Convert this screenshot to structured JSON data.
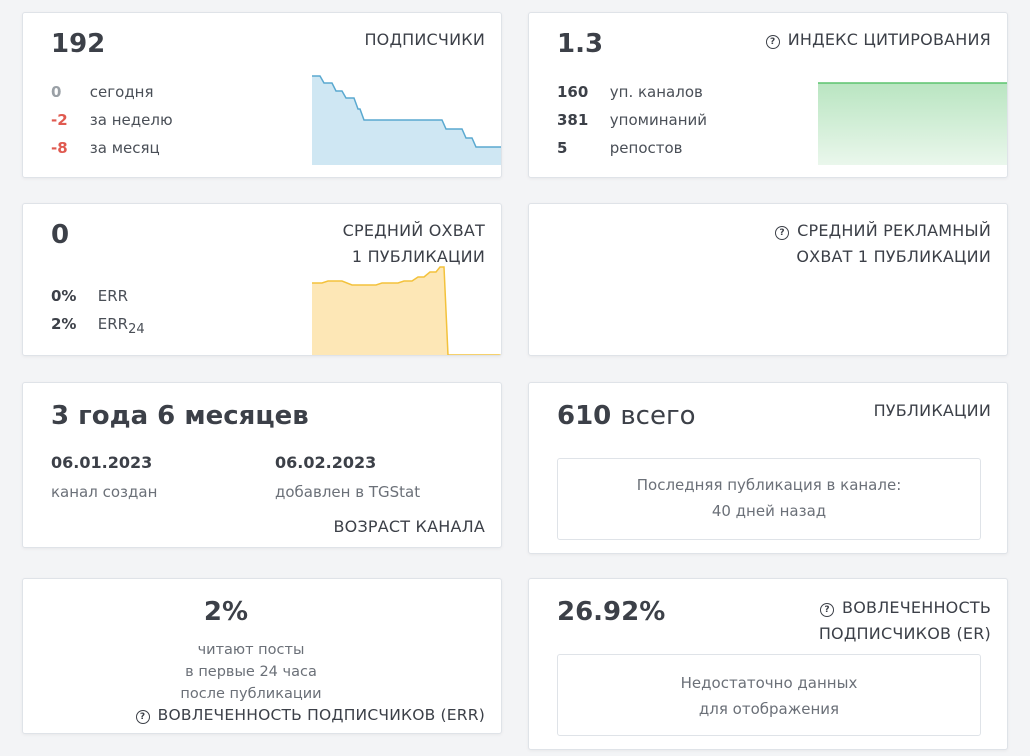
{
  "subscribers": {
    "value": "192",
    "title": "ПОДПИСЧИКИ",
    "rows": [
      {
        "num": "0",
        "label": "сегодня"
      },
      {
        "num": "-2",
        "label": "за неделю"
      },
      {
        "num": "-8",
        "label": "за месяц"
      }
    ]
  },
  "citation": {
    "value": "1.3",
    "title": "ИНДЕКС ЦИТИРОВАНИЯ",
    "rows": [
      {
        "num": "160",
        "label": "уп. каналов"
      },
      {
        "num": "381",
        "label": "упоминаний"
      },
      {
        "num": "5",
        "label": "репостов"
      }
    ]
  },
  "reach": {
    "value": "0",
    "title_line1": "СРЕДНИЙ ОХВАТ",
    "title_line2": "1 ПУБЛИКАЦИИ",
    "err_value": "0%",
    "err_label": "ERR",
    "err24_value": "2%",
    "err24_label": "ERR",
    "err24_sub": "24"
  },
  "ad_reach": {
    "title_line1": "СРЕДНИЙ РЕКЛАМНЫЙ",
    "title_line2": "ОХВАТ 1 ПУБЛИКАЦИИ"
  },
  "age": {
    "value": "3 года 6 месяцев",
    "created_date": "06.01.2023",
    "created_label": "канал создан",
    "added_date": "06.02.2023",
    "added_label": "добавлен в TGStat",
    "title": "ВОЗРАСТ КАНАЛА"
  },
  "posts": {
    "value": "610",
    "value_suffix": "всего",
    "title": "ПУБЛИКАЦИИ",
    "last_line1": "Последняя публикация в канале:",
    "last_line2": "40 дней назад"
  },
  "err_card": {
    "value": "2%",
    "desc_line1": "читают посты",
    "desc_line2": "в первые 24 часа",
    "desc_line3": "после публикации",
    "title": "ВОВЛЕЧЕННОСТЬ ПОДПИСЧИКОВ (ERR)"
  },
  "er_card": {
    "value": "26.92%",
    "title_line1": "ВОВЛЕЧЕННОСТЬ",
    "title_line2": "ПОДПИСЧИКОВ (ER)",
    "empty_line1": "Недостаточно данных",
    "empty_line2": "для отображения"
  },
  "colors": {
    "blue_line": "#5aa9d0",
    "blue_fill": "#cfe7f3",
    "green_line": "#5cc46f",
    "green_fill": "#dff3e2",
    "yellow_line": "#f3c23c",
    "yellow_fill": "#fde7b6",
    "red": "#e05a50"
  }
}
